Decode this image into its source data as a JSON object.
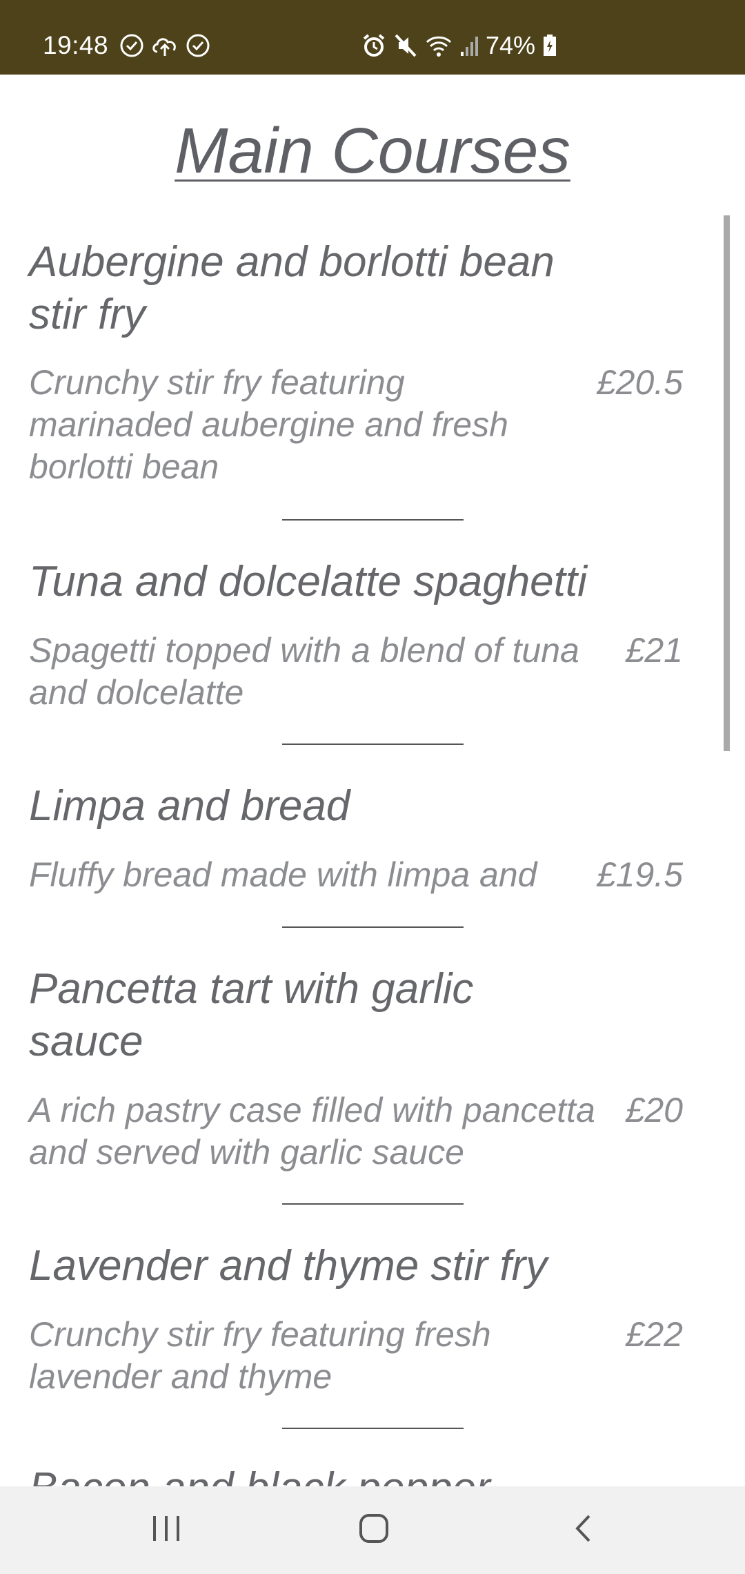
{
  "status_bar": {
    "time": "19:48",
    "left_icons": [
      "check-circle-icon",
      "cloud-upload-icon",
      "check-circle-icon"
    ],
    "right_icons": [
      "alarm-icon",
      "mute-icon",
      "wifi-icon",
      "signal-icon",
      "battery-charging-icon"
    ],
    "battery": "74%",
    "background_color": "#4d4219"
  },
  "page": {
    "title": "Main Courses"
  },
  "dishes": [
    {
      "name": "Aubergine and borlotti bean stir fry",
      "description": "Crunchy stir fry featuring marinaded aubergine and fresh borlotti bean",
      "price": "£20.5"
    },
    {
      "name": "Tuna and dolcelatte spaghetti",
      "description": "Spagetti topped with a blend of tuna and dolcelatte",
      "price": "£21"
    },
    {
      "name": "Limpa and bread",
      "description": "Fluffy bread made with limpa and",
      "price": "£19.5"
    },
    {
      "name": "Pancetta tart with garlic sauce",
      "description": "A rich pastry case filled with pancetta and served with garlic sauce",
      "price": "£20"
    },
    {
      "name": "Lavender and thyme stir fry",
      "description": "Crunchy stir fry featuring fresh lavender and thyme",
      "price": "£22"
    },
    {
      "name": "Bacon and black pepper",
      "description": "",
      "price": ""
    }
  ],
  "nav": {
    "buttons": [
      "recent-apps-icon",
      "home-icon",
      "back-icon"
    ]
  }
}
